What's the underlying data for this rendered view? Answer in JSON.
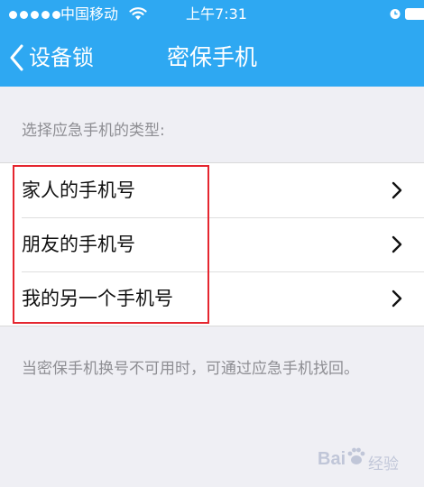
{
  "status_bar": {
    "carrier": "中国移动",
    "time": "上午7:31",
    "signal_icon": "signal-dots-icon",
    "wifi_icon": "wifi-icon",
    "alarm_icon": "alarm-clock-icon",
    "battery_icon": "battery-icon"
  },
  "nav": {
    "back_label": "设备锁",
    "title": "密保手机",
    "back_icon": "chevron-left-icon"
  },
  "section_header": "选择应急手机的类型:",
  "items": [
    {
      "label": "家人的手机号",
      "icon": "chevron-right-icon"
    },
    {
      "label": "朋友的手机号",
      "icon": "chevron-right-icon"
    },
    {
      "label": "我的另一个手机号",
      "icon": "chevron-right-icon"
    }
  ],
  "footer_note": "当密保手机换号不可用时，可通过应急手机找回。",
  "watermark": {
    "text": "Bai",
    "sub": "经验"
  },
  "colors": {
    "accent": "#2ea8f2",
    "highlight": "#e5262f",
    "background": "#efeff4"
  }
}
